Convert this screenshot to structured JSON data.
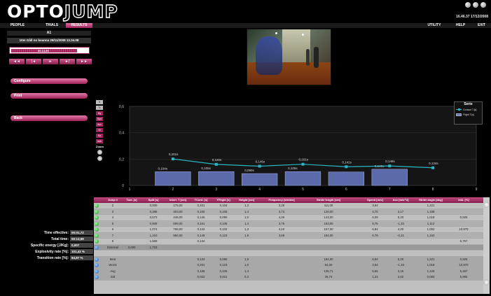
{
  "app": {
    "logo_left": "OPTO",
    "logo_right": "JUMP",
    "clock": "16.46.37  17/12/2008"
  },
  "nav": {
    "left_tabs": [
      "PEOPLE",
      "TRIALS",
      "RESULTS"
    ],
    "active_tab": "RESULTS",
    "right_tabs": [
      "UTILITY",
      "HELP",
      "EXIT"
    ]
  },
  "left": {
    "test_id": "A1",
    "test_title": "10m Gåll no beanna 29/11/2008 13.34.08",
    "timeline_time": "00.13,99",
    "timeline_progress": 0.85,
    "playback": [
      "◄◄",
      "|◄",
      "►",
      "►|",
      "►►"
    ],
    "buttons": [
      "Configure",
      "Print",
      "Back"
    ],
    "stats": [
      {
        "label": "Time effective:",
        "value": "00:01,72"
      },
      {
        "label": "Total time:",
        "value": "00:13,99"
      },
      {
        "label": "Specific energy [J/Kg]:",
        "value": "0,007"
      },
      {
        "label": "Explosivity rate [%]:",
        "value": "101,42 %"
      },
      {
        "label": "Transition rate [%]:",
        "value": "84,87 %"
      }
    ]
  },
  "chart_tools": [
    "H",
    "Tc",
    "Hg",
    "Spd",
    "Acc",
    "St",
    "Sa",
    "Imb"
  ],
  "zoom_label": "Zoom",
  "chart_data": {
    "type": "bar",
    "x": [
      1,
      2,
      3,
      4,
      5,
      6,
      7,
      8,
      9
    ],
    "xlim": [
      1,
      9
    ],
    "ylim": [
      0,
      0.6
    ],
    "yticks": [
      "0",
      "0,2",
      "0,4",
      "0,6"
    ],
    "bars": {
      "x": [
        2,
        3,
        4,
        5,
        6,
        7
      ],
      "values": [
        0.104,
        0.105,
        0.09,
        0.105,
        0.102,
        0.123
      ],
      "labels": [
        "0,104s",
        "0,105s",
        "0,090s",
        "0,105s",
        "",
        "0,148s"
      ]
    },
    "line": {
      "x": [
        2,
        3,
        4,
        5,
        6,
        7,
        8
      ],
      "values": [
        0.201,
        0.16,
        0.146,
        0.161,
        0.142,
        0.148,
        0.134
      ],
      "labels": [
        "0,201s",
        "0,160s",
        "0,146s",
        "0,161s",
        "0,142s",
        "0,148s",
        "0,134s"
      ]
    },
    "legend": {
      "title": "Serie",
      "line_label": "Contact T.[s]",
      "bar_label": "Flight T.[s]"
    }
  },
  "table": {
    "headers": [
      "Jump #",
      "Tact. [s]",
      "Split [s]",
      "Interl. T [cm]",
      "TCont. [s]",
      "TFlight [s]",
      "Height [cm]",
      "Frequency [strides]",
      "Stride length [cm]",
      "Speed [m/s]",
      "Acc [m/s^2]",
      "Stride angle [deg]",
      "Imb. [%]"
    ],
    "rows": [
      {
        "icon": "green",
        "cells": [
          "2",
          "",
          "0,000",
          "175,00",
          "0,201",
          "0,104",
          "1,3",
          "3,28",
          "111,00",
          "3,64",
          "",
          "1,221",
          ""
        ]
      },
      {
        "icon": "green",
        "cells": [
          "3",
          "",
          "0,385",
          "303,00",
          "0,160",
          "0,105",
          "1,4",
          "3,73",
          "128,00",
          "4,70",
          "3,17",
          "1,158",
          ""
        ]
      },
      {
        "icon": "green",
        "cells": [
          "4",
          "",
          "0,573",
          "446,00",
          "0,145",
          "0,090",
          "1,0",
          "4,26",
          "143,00",
          "6,09",
          "5,20",
          "1,018",
          "0,925"
        ]
      },
      {
        "icon": "green",
        "cells": [
          "5",
          "",
          "0,808",
          "599,00",
          "0,161",
          "0,105",
          "1,4",
          "3,76",
          "153,00",
          "5,75",
          "-1,33",
          "1,112",
          ""
        ]
      },
      {
        "icon": "green",
        "cells": [
          "6",
          "",
          "1,074",
          "766,00",
          "0,142",
          "0,102",
          "1,3",
          "4,10",
          "167,00",
          "6,84",
          "4,20",
          "1,052",
          "10,870"
        ]
      },
      {
        "icon": "green",
        "cells": [
          "7",
          "",
          "1,310",
          "950,00",
          "0,148",
          "0,123",
          "1,9",
          "3,69",
          "184,00",
          "6,79",
          "-0,21",
          "1,163",
          ""
        ]
      },
      {
        "icon": "green",
        "cells": [
          "8",
          "",
          "1,589",
          "",
          "0,134",
          "",
          "",
          "",
          "",
          "",
          "",
          "",
          "6,757"
        ]
      },
      {
        "icon": "blue",
        "ext": true,
        "cells": [
          "External",
          "3,000",
          "1,723",
          "",
          "",
          "",
          "",
          "",
          "",
          "",
          "",
          "",
          ""
        ]
      }
    ],
    "summary": [
      {
        "cells": [
          "Best",
          "",
          "",
          "",
          "0,134",
          "0,090",
          "1,9",
          "",
          "184,00",
          "6,84",
          "5,20",
          "1,221",
          "0,925"
        ]
      },
      {
        "cells": [
          "Worst",
          "",
          "",
          "",
          "0,201",
          "0,123",
          "1,0",
          "",
          "64,00",
          "3,64",
          "-1,33",
          "1,018",
          "10,870"
        ]
      },
      {
        "cells": [
          "Avg",
          "",
          "",
          "",
          "0,156",
          "0,105",
          "1,4",
          "",
          "135,71",
          "5,65",
          "3,16",
          "1,126",
          "5,467"
        ]
      },
      {
        "cells": [
          "Std",
          "",
          "",
          "",
          "0,022",
          "0,011",
          "0,3",
          "",
          "39,74",
          "1,24",
          "2,02",
          "0,083",
          "5,993"
        ]
      }
    ]
  }
}
